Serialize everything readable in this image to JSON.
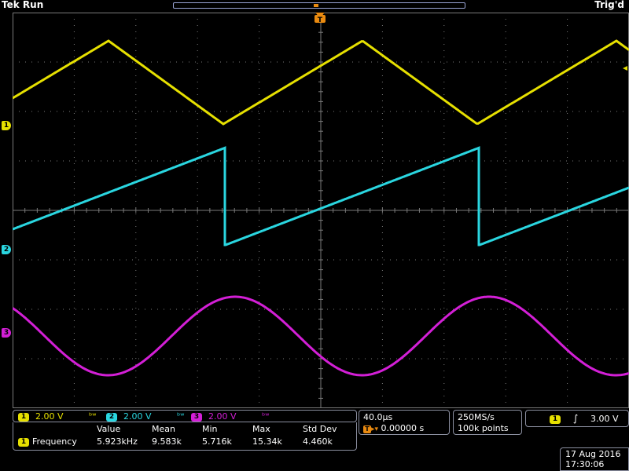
{
  "header": {
    "brand": "Tek",
    "state": "Run",
    "trigger_status": "Trig'd",
    "trigger_marker": "T"
  },
  "colors": {
    "ch1": "#e6e000",
    "ch2": "#2ad6e0",
    "ch3": "#d31fd6",
    "trigger": "#e98a10",
    "grid": "#7a7a7a"
  },
  "channels": [
    {
      "id": "1",
      "scale": "2.00 V"
    },
    {
      "id": "2",
      "scale": "2.00 V"
    },
    {
      "id": "3",
      "scale": "2.00 V"
    }
  ],
  "timebase": {
    "per_div": "40.0µs",
    "delay": "0.00000 s"
  },
  "acquisition": {
    "sample_rate": "250MS/s",
    "record_length": "100k points"
  },
  "trigger": {
    "source": "1",
    "level": "3.00 V"
  },
  "measurement": {
    "headers": [
      "Value",
      "Mean",
      "Min",
      "Max",
      "Std Dev"
    ],
    "channel": "1",
    "name": "Frequency",
    "values": [
      "5.923kHz",
      "9.583k",
      "5.716k",
      "15.34k",
      "4.460k"
    ]
  },
  "clock": {
    "date": "17 Aug 2016",
    "time": "17:30:06"
  }
}
